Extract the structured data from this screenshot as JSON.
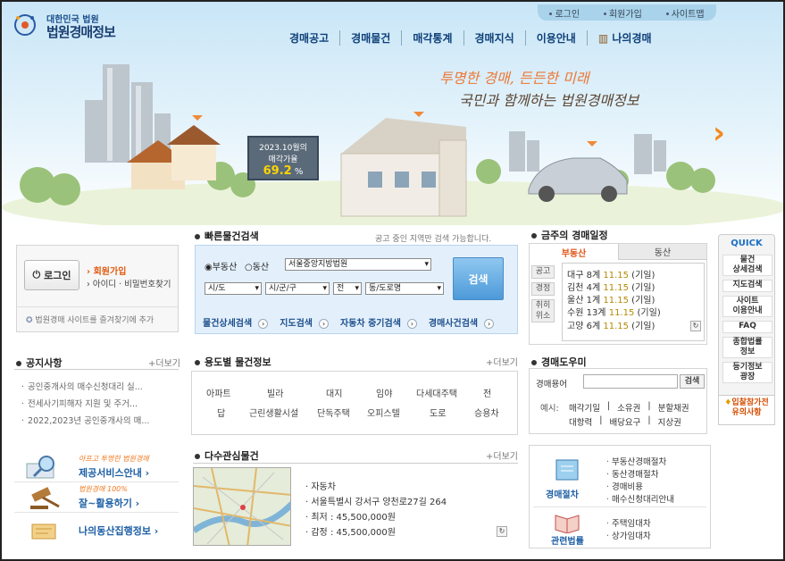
{
  "brand": {
    "line1": "대한민국 법원",
    "line2": "법원경매정보"
  },
  "top_menu": [
    "로그인",
    "회원가입",
    "사이트맵"
  ],
  "gnb": [
    "경매공고",
    "경매물건",
    "매각통계",
    "경매지식",
    "이용안내",
    "나의경매"
  ],
  "hero": {
    "slogan1": "투명한 경매, 든든한 미래",
    "slogan2": "국민과 함께하는 법원경매정보",
    "rate_label1": "2023.10월의",
    "rate_label2": "매각가율",
    "rate_value": "69.2",
    "rate_unit": "%"
  },
  "login": {
    "button": "로그인",
    "join": "회원가입",
    "find": "아이디 · 비밀번호찾기",
    "favorite": "법원경매 사이트를 즐겨찾기에 추가"
  },
  "quick_search": {
    "title": "빠른물건검색",
    "note": "공고 중인 지역만 검색 가능합니다.",
    "radio_realty": "부동산",
    "radio_movable": "동산",
    "court": "서울중앙지방법원",
    "sido": "시/도",
    "sigungu": "시/군/구",
    "all": "전",
    "road": "동/도로명",
    "search": "검색",
    "links": [
      "물건상세검색",
      "지도검색",
      "자동차 중기검색",
      "경매사건검색"
    ]
  },
  "schedule": {
    "title": "금주의 경매일정",
    "tabs": [
      "부동산",
      "동산"
    ],
    "labels": [
      "공고",
      "경정",
      "취히위소"
    ],
    "rows": [
      {
        "place": "대구 8계",
        "date": "11.15",
        "state": "(기일)"
      },
      {
        "place": "김천 4계",
        "date": "11.15",
        "state": "(기일)"
      },
      {
        "place": "울산 1계",
        "date": "11.15",
        "state": "(기일)"
      },
      {
        "place": "수원 13계",
        "date": "11.15",
        "state": "(기일)"
      },
      {
        "place": "고양 6계",
        "date": "11.15",
        "state": "(기일)"
      }
    ]
  },
  "quick": {
    "title": "QUICK",
    "items": [
      "물건\n상세검색",
      "지도검색",
      "사이트\n이용안내",
      "FAQ",
      "종합법률\n정보",
      "등기정보\n광장"
    ],
    "caution": "입찰참가전\n유의사항"
  },
  "notice": {
    "title": "공지사항",
    "more": "더보기",
    "items": [
      "공인중개사의 매수신청대리 실...",
      "전세사기피해자 지원 및 주거...",
      "2022,2023년 공인중개사의 매..."
    ]
  },
  "usage": {
    "title": "용도별 물건정보",
    "more": "더보기",
    "row1": [
      "아파트",
      "빌라",
      "대지",
      "임야",
      "다세대주택",
      "전"
    ],
    "row2": [
      "답",
      "근린생활시설",
      "단독주택",
      "오피스텔",
      "도로",
      "승용차"
    ]
  },
  "help": {
    "title": "경매도우미",
    "term_label": "경매용어",
    "search": "검색",
    "example": "예시:",
    "terms1": [
      "매각기일",
      "소유권",
      "분할채권"
    ],
    "terms2": [
      "대항력",
      "배당요구",
      "지상권"
    ]
  },
  "banners": [
    {
      "sub": "아프고 투명한 법원경매",
      "title": "제공서비스안내"
    },
    {
      "sub": "법원경매 100%",
      "title": "잘~활용하기"
    },
    {
      "sub": "",
      "title": "나의동산집행정보"
    }
  ],
  "multi": {
    "title": "다수관심물건",
    "more": "더보기",
    "items": [
      "자동차",
      "서울특별시 강서구 양천로27길 264",
      "최저 : 45,500,000원",
      "감정 : 45,500,000원"
    ]
  },
  "procedures": {
    "label1": "경매절차",
    "links1": [
      "부동산경매절차",
      "동산경매절차",
      "경매비용",
      "매수신청대리안내"
    ],
    "label2": "관련법률",
    "links2": [
      "주택임대차",
      "상가임대차"
    ]
  }
}
